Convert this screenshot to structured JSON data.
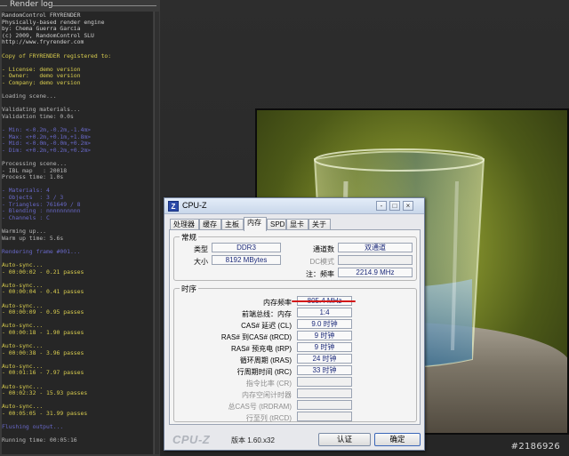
{
  "render_log": {
    "title": "Render log",
    "lines": [
      {
        "text": "RandomControl FRYRENDER",
        "color": "white"
      },
      {
        "text": "Physically-based render engine",
        "color": "white"
      },
      {
        "text": "by: Chema Guerra Garcia",
        "color": "white"
      },
      {
        "text": "(c) 2009, RandomControl SLU",
        "color": "white"
      },
      {
        "text": "http://www.fryrender.com",
        "color": "white"
      },
      {
        "text": "",
        "color": "white"
      },
      {
        "text": "Copy of FRYRENDER registered to:",
        "color": "yellow"
      },
      {
        "text": "",
        "color": "white"
      },
      {
        "text": "- License: demo version",
        "color": "yellow"
      },
      {
        "text": "- Owner:   demo version",
        "color": "yellow"
      },
      {
        "text": "- Company: demo version",
        "color": "yellow"
      },
      {
        "text": "",
        "color": "white"
      },
      {
        "text": "Loading scene...",
        "color": "dim"
      },
      {
        "text": "",
        "color": "white"
      },
      {
        "text": "Validating materials...",
        "color": "dim"
      },
      {
        "text": "Validation time: 0.0s",
        "color": "dim"
      },
      {
        "text": "",
        "color": "white"
      },
      {
        "text": "- Min: <-0.2m,-0.2m,-1.4m>",
        "color": "blue"
      },
      {
        "text": "- Max: <+0.2m,+0.1m,+1.8m>",
        "color": "blue"
      },
      {
        "text": "- Mid: <-0.0m,-0.0m,+0.2m>",
        "color": "blue"
      },
      {
        "text": "- Dim: <+0.2m,+0.2m,+0.2m>",
        "color": "blue"
      },
      {
        "text": "",
        "color": "white"
      },
      {
        "text": "Processing scene...",
        "color": "dim"
      },
      {
        "text": "- IBL map   : 20018",
        "color": "dim"
      },
      {
        "text": "Process time: 1.0s",
        "color": "dim"
      },
      {
        "text": "",
        "color": "white"
      },
      {
        "text": "- Materials: 4",
        "color": "blue"
      },
      {
        "text": "- Objects  : 3 / 3",
        "color": "blue"
      },
      {
        "text": "- Triangles: 761649 / 8",
        "color": "blue"
      },
      {
        "text": "- Blending : nnnnnnnnnn",
        "color": "blue"
      },
      {
        "text": "- Channels : C",
        "color": "blue"
      },
      {
        "text": "",
        "color": "white"
      },
      {
        "text": "Warming up...",
        "color": "dim"
      },
      {
        "text": "Warm up time: 5.6s",
        "color": "dim"
      },
      {
        "text": "",
        "color": "white"
      },
      {
        "text": "Rendering frame #001...",
        "color": "blue"
      },
      {
        "text": "",
        "color": "white"
      },
      {
        "text": "Auto-sync...",
        "color": "yellow"
      },
      {
        "text": "- 00:00:02 - 0.21 passes",
        "color": "yellow"
      },
      {
        "text": "",
        "color": "white"
      },
      {
        "text": "Auto-sync...",
        "color": "yellow"
      },
      {
        "text": "- 00:00:04 - 0.41 passes",
        "color": "yellow"
      },
      {
        "text": "",
        "color": "white"
      },
      {
        "text": "Auto-sync...",
        "color": "yellow"
      },
      {
        "text": "- 00:00:09 - 0.95 passes",
        "color": "yellow"
      },
      {
        "text": "",
        "color": "white"
      },
      {
        "text": "Auto-sync...",
        "color": "yellow"
      },
      {
        "text": "- 00:00:18 - 1.90 passes",
        "color": "yellow"
      },
      {
        "text": "",
        "color": "white"
      },
      {
        "text": "Auto-sync...",
        "color": "yellow"
      },
      {
        "text": "- 00:00:38 - 3.96 passes",
        "color": "yellow"
      },
      {
        "text": "",
        "color": "white"
      },
      {
        "text": "Auto-sync...",
        "color": "yellow"
      },
      {
        "text": "- 00:01:16 - 7.97 passes",
        "color": "yellow"
      },
      {
        "text": "",
        "color": "white"
      },
      {
        "text": "Auto-sync...",
        "color": "yellow"
      },
      {
        "text": "- 00:02:32 - 15.93 passes",
        "color": "yellow"
      },
      {
        "text": "",
        "color": "white"
      },
      {
        "text": "Auto-sync...",
        "color": "yellow"
      },
      {
        "text": "- 00:05:05 - 31.99 passes",
        "color": "yellow"
      },
      {
        "text": "",
        "color": "white"
      },
      {
        "text": "Flushing output...",
        "color": "blue"
      },
      {
        "text": "",
        "color": "white"
      },
      {
        "text": "Running time: 00:05:16",
        "color": "dim"
      }
    ],
    "colors": {
      "white": "#cfcfcf",
      "yellow": "#d8cc4e",
      "blue": "#6868c8",
      "dim": "#b8b8b8"
    }
  },
  "watermark": "#2186926",
  "cpuz": {
    "title": "CPU-Z",
    "app_icon": "Z",
    "window_buttons": {
      "minimize": "-",
      "maximize": "□",
      "close": "×"
    },
    "tabs": [
      {
        "label": "处理器",
        "active": false
      },
      {
        "label": "缓存",
        "active": false
      },
      {
        "label": "主板",
        "active": false
      },
      {
        "label": "内存",
        "active": true
      },
      {
        "label": "SPD",
        "active": false
      },
      {
        "label": "显卡",
        "active": false
      },
      {
        "label": "关于",
        "active": false
      }
    ],
    "general": {
      "legend": "常规",
      "type_label": "类型",
      "type_value": "DDR3",
      "size_label": "大小",
      "size_value": "8192 MBytes",
      "channels_label": "通道数",
      "channels_value": "双通道",
      "dc_mode_label": "DC模式",
      "dc_mode_value": "",
      "nb_freq_label": "注：频率",
      "nb_freq_value": "2214.9 MHz"
    },
    "timings": {
      "legend": "时序",
      "rows": [
        {
          "label": "内存频率",
          "value": "805.4 MHz",
          "disabled": false
        },
        {
          "label": "前端总线：内存",
          "value": "1:4",
          "disabled": false
        },
        {
          "label": "CAS# 延迟 (CL)",
          "value": "9.0 时钟",
          "disabled": false
        },
        {
          "label": "RAS# 到CAS# (tRCD)",
          "value": "9 时钟",
          "disabled": false
        },
        {
          "label": "RAS# 预充电 (tRP)",
          "value": "9 时钟",
          "disabled": false
        },
        {
          "label": "循环周期 (tRAS)",
          "value": "24 时钟",
          "disabled": false
        },
        {
          "label": "行周期时间 (tRC)",
          "value": "33 时钟",
          "disabled": false
        },
        {
          "label": "指令比率 (CR)",
          "value": "",
          "disabled": true
        },
        {
          "label": "内存空闲计时器",
          "value": "",
          "disabled": true
        },
        {
          "label": "总CAS号 (tRDRAM)",
          "value": "",
          "disabled": true
        },
        {
          "label": "行至列 (tRCD)",
          "value": "",
          "disabled": true
        }
      ]
    },
    "brand": "CPU-Z",
    "version": "版本 1.60.x32",
    "validate_button": "认证",
    "ok_button": "确定",
    "highlight_color": "#d21818"
  }
}
